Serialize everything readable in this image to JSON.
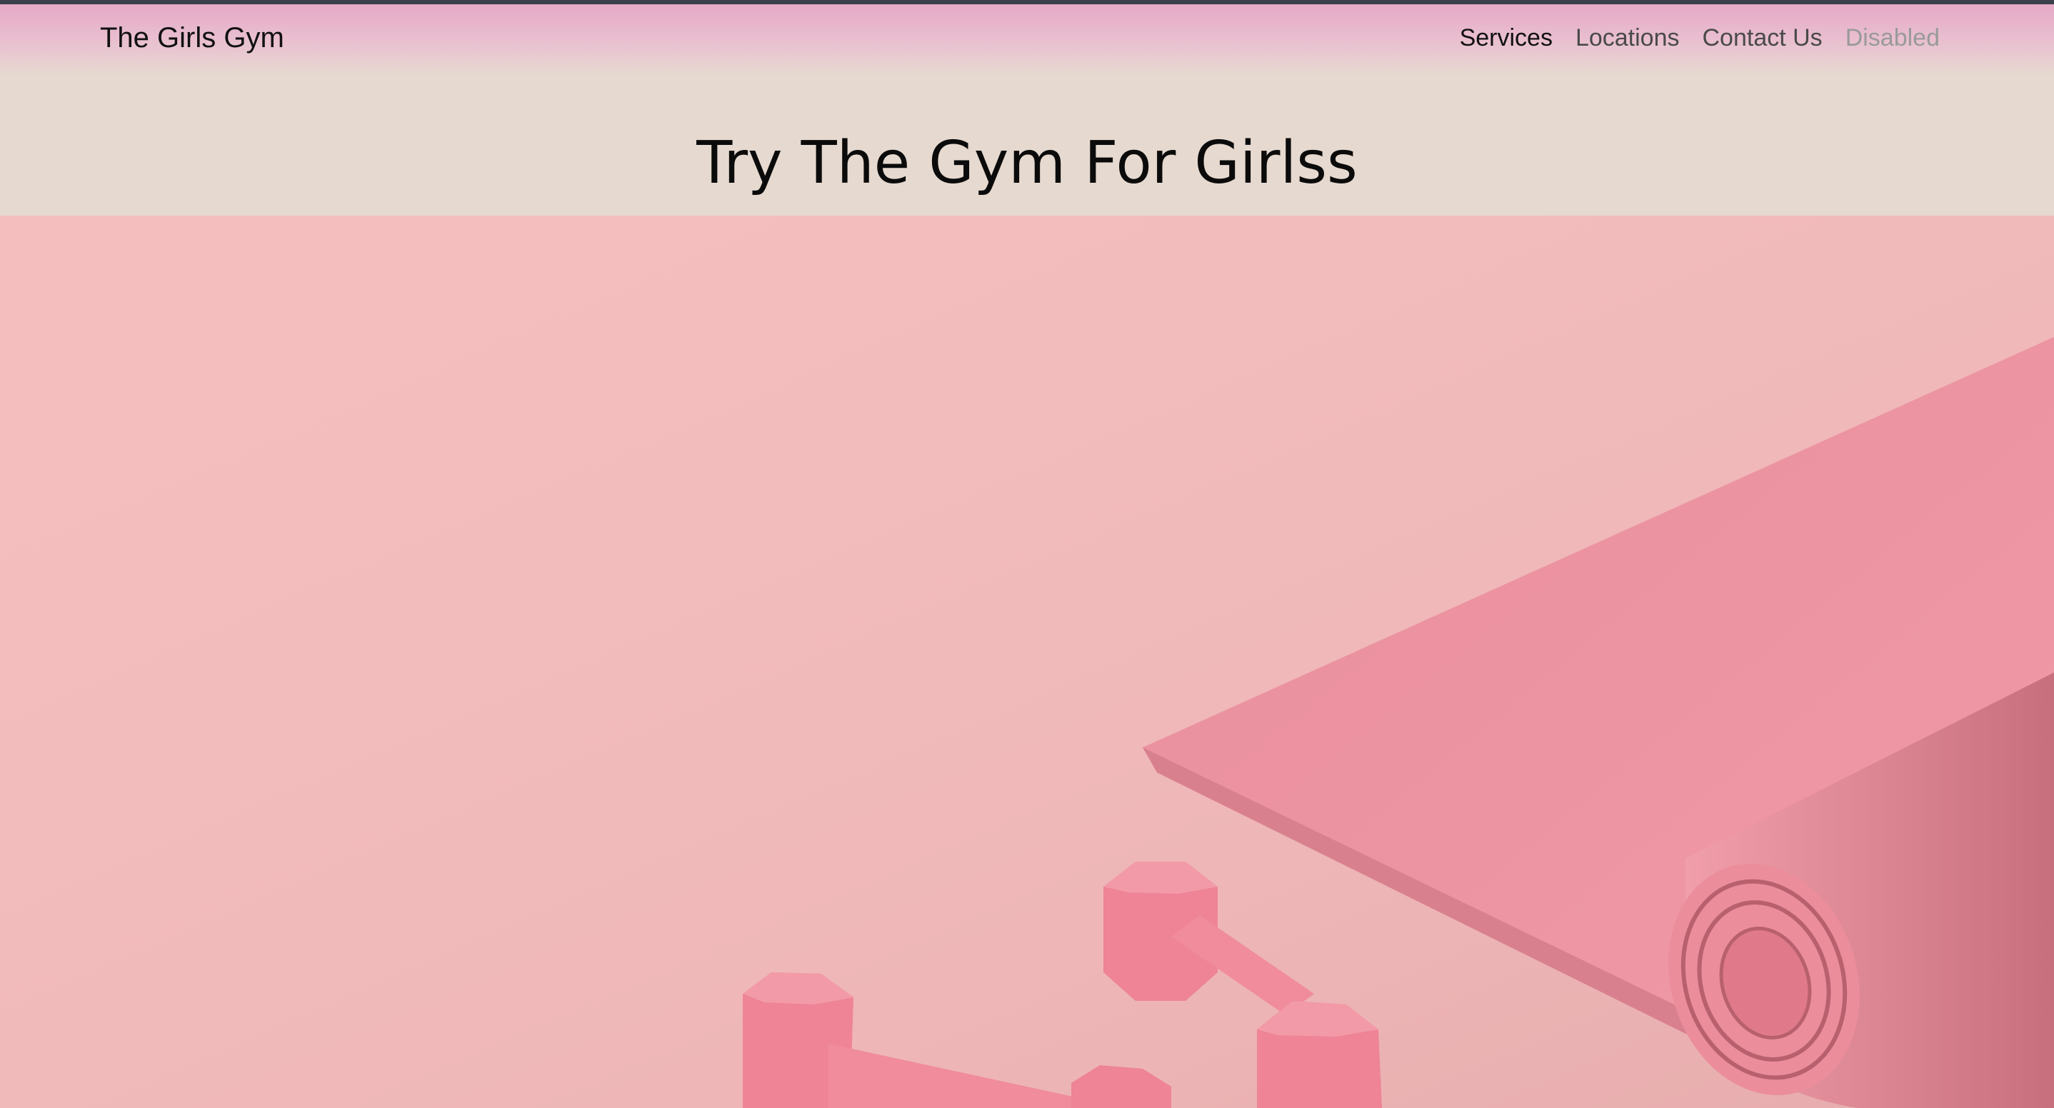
{
  "navbar": {
    "brand": "The Girls Gym",
    "links": [
      {
        "label": "Services",
        "state": "active"
      },
      {
        "label": "Locations",
        "state": "normal"
      },
      {
        "label": "Contact Us",
        "state": "normal"
      },
      {
        "label": "Disabled",
        "state": "disabled"
      }
    ]
  },
  "hero": {
    "title": "Try The Gym For Girlss"
  },
  "colors": {
    "navbar_top": "#e6a9c6",
    "hero_band": "#e6d9cf",
    "image_background": "#f4bebe",
    "mat": "#ec94a2",
    "dumbbell": "#ee8496"
  }
}
